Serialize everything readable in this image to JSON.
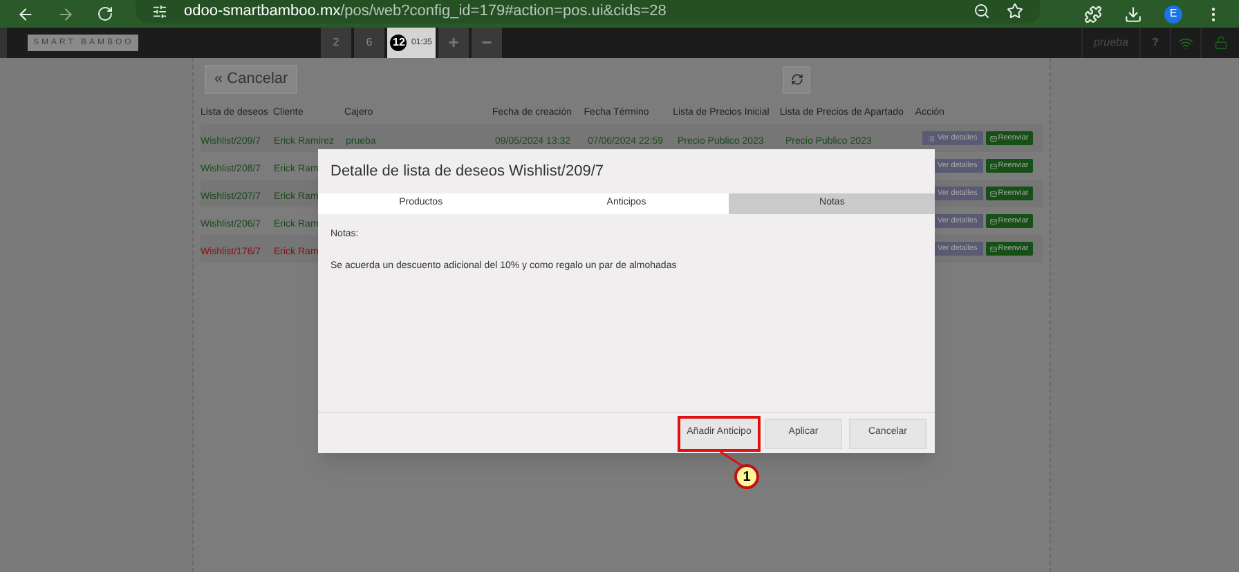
{
  "browser": {
    "url_host": "odoo-smartbamboo.mx",
    "url_path": "/pos/web?config_id=179#action=pos.ui&cids=28",
    "profile": "E"
  },
  "pos_bar": {
    "logo": "SMART BAMBOO",
    "orders": [
      {
        "label": "2",
        "selected": false
      },
      {
        "label": "6",
        "selected": false
      },
      {
        "label": "12",
        "time": "01:35",
        "selected": true
      }
    ],
    "add": "+",
    "remove": "−",
    "user": "prueba",
    "help": "?"
  },
  "toolbar": {
    "cancel": "« Cancelar"
  },
  "table": {
    "columns": [
      "Lista de deseos",
      "Cliente",
      "Cajero",
      "Fecha de creación",
      "Fecha Término",
      "Lista de Precios Inicial",
      "Lista de Precios de Apartado",
      "Acción"
    ],
    "rows": [
      {
        "cells": [
          "Wishlist/209/7",
          "Erick Ramirez",
          "prueba",
          "09/05/2024 13:32",
          "07/06/2024 22:59",
          "Precio Publico 2023",
          "Precio Publico 2023"
        ],
        "expired": false,
        "details": "Ver detalles",
        "resend": "Reenviar"
      },
      {
        "cells": [
          "Wishlist/208/7",
          "Erick Ram"
        ],
        "expired": false,
        "details": "Ver detalles",
        "resend": "Reenviar"
      },
      {
        "cells": [
          "Wishlist/207/7",
          "Erick Ram"
        ],
        "expired": false,
        "details": "Ver detalles",
        "resend": "Reenviar"
      },
      {
        "cells": [
          "Wishlist/206/7",
          "Erick Ram"
        ],
        "expired": false,
        "details": "Ver detalles",
        "resend": "Reenviar"
      },
      {
        "cells": [
          "Wishlist/176/7",
          "Erick Ram"
        ],
        "expired": true,
        "details": "Ver detalles",
        "resend": "Reenviar"
      }
    ]
  },
  "modal": {
    "title": "Detalle de lista de deseos Wishlist/209/7",
    "tabs": [
      {
        "label": "Productos",
        "selected": false
      },
      {
        "label": "Anticipos",
        "selected": false
      },
      {
        "label": "Notas",
        "selected": true
      }
    ],
    "notes_label": "Notas:",
    "notes": "Se acuerda un descuento adicional del 10% y como regalo un par de almohadas",
    "buttons": [
      {
        "label": "Añadir Anticipo",
        "highlighted": true
      },
      {
        "label": "Aplicar",
        "highlighted": false
      },
      {
        "label": "Cancelar",
        "highlighted": false
      }
    ]
  },
  "callout": {
    "number": "1"
  }
}
